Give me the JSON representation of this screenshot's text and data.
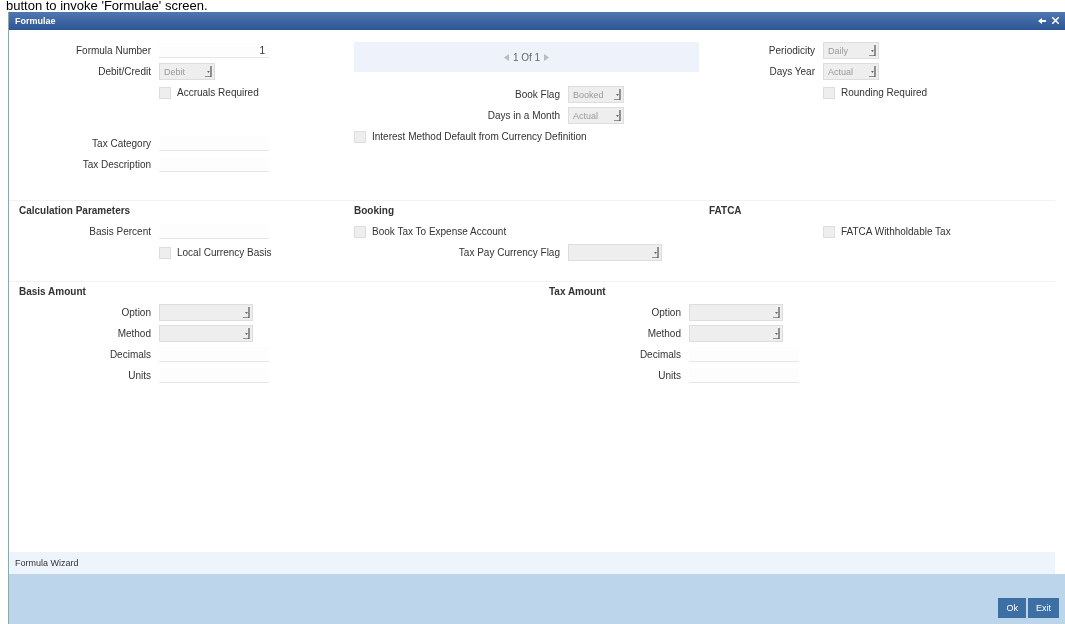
{
  "caption": "button to invoke 'Formulae' screen.",
  "window": {
    "title": "Formulae"
  },
  "pager": {
    "text": "1 Of 1"
  },
  "header_columns": [
    [
      {
        "kind": "text",
        "label": "Formula Number",
        "value": "1"
      },
      {
        "kind": "select",
        "label": "Debit/Credit",
        "value": "Debit"
      },
      {
        "kind": "checkbox",
        "label": "Accruals Required",
        "checked": false
      },
      {
        "kind": "spacer"
      },
      {
        "kind": "text",
        "label": "Tax Category"
      },
      {
        "kind": "text",
        "label": "Tax Description"
      }
    ],
    [
      {
        "kind": "select",
        "label": "Book Flag",
        "value": "Booked"
      },
      {
        "kind": "select",
        "label": "Days in a Month",
        "value": "Actual"
      },
      {
        "kind": "checkbox",
        "label": "Interest Method Default from Currency Definition",
        "checked": false
      }
    ],
    [
      {
        "kind": "select",
        "label": "Periodicity",
        "value": "Daily"
      },
      {
        "kind": "select",
        "label": "Days Year",
        "value": "Actual"
      },
      {
        "kind": "checkbox",
        "label": "Rounding Required",
        "checked": false
      }
    ]
  ],
  "sections": [
    {
      "title": "Calculation Parameters",
      "fields": [
        {
          "kind": "text",
          "label": "Basis Percent"
        },
        {
          "kind": "checkbox",
          "label": "Local Currency Basis",
          "checked": false
        }
      ]
    },
    {
      "title": "Booking",
      "fields": [
        {
          "kind": "checkbox",
          "label": "Book Tax To Expense Account",
          "checked": false
        },
        {
          "kind": "select",
          "label": "Tax Pay Currency Flag"
        }
      ]
    },
    {
      "title": "FATCA",
      "fields": [
        {
          "kind": "checkbox",
          "label": "FATCA Withholdable Tax",
          "checked": false
        }
      ]
    }
  ],
  "amount_sections": [
    {
      "title": "Basis Amount",
      "fields": [
        {
          "kind": "select",
          "label": "Option"
        },
        {
          "kind": "select",
          "label": "Method"
        },
        {
          "kind": "text",
          "label": "Decimals"
        },
        {
          "kind": "text",
          "label": "Units"
        }
      ]
    },
    {
      "title": "Tax Amount",
      "fields": [
        {
          "kind": "select",
          "label": "Option"
        },
        {
          "kind": "select",
          "label": "Method"
        },
        {
          "kind": "text",
          "label": "Decimals"
        },
        {
          "kind": "text",
          "label": "Units"
        }
      ]
    }
  ],
  "wizard": {
    "label": "Formula Wizard"
  },
  "buttons": [
    "Ok",
    "Exit"
  ]
}
